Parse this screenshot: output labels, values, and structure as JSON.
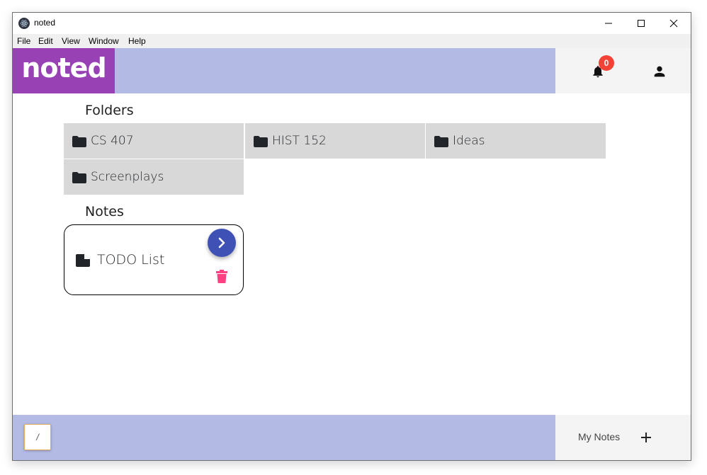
{
  "window": {
    "title": "noted",
    "controls": {
      "minimize": "minimize",
      "maximize": "maximize",
      "close": "close"
    }
  },
  "menu": [
    "File",
    "Edit",
    "View",
    "Window",
    "Help"
  ],
  "header": {
    "logo": "noted",
    "notification_count": "0",
    "colors": {
      "logo_bg": "#9841b5",
      "bar_bg": "#b3bae4",
      "badge": "#f44336"
    }
  },
  "folders": {
    "title": "Folders",
    "items": [
      {
        "label": "CS 407",
        "icon": "folder-icon"
      },
      {
        "label": "HIST 152",
        "icon": "folder-icon"
      },
      {
        "label": "Ideas",
        "icon": "folder-icon"
      },
      {
        "label": "Screenplays",
        "icon": "folder-icon"
      }
    ]
  },
  "notes": {
    "title": "Notes",
    "items": [
      {
        "label": "TODO List",
        "icon": "document-icon",
        "open_color": "#3f51b5",
        "delete_color": "#ff4081"
      }
    ]
  },
  "footer": {
    "path": "/",
    "section_label": "My Notes",
    "add_icon": "plus-icon"
  }
}
